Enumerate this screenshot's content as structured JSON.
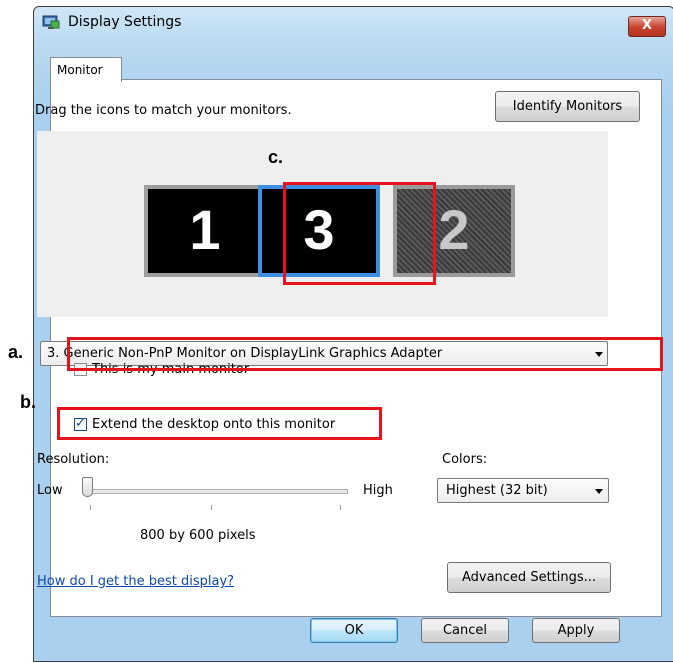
{
  "window": {
    "title": "Display Settings",
    "close_glyph": "X"
  },
  "tabs": [
    {
      "label": "Monitor"
    }
  ],
  "monitor_tab": {
    "drag_hint": "Drag the icons to match your monitors.",
    "identify_button": "Identify Monitors",
    "monitors": [
      {
        "number": "1",
        "selected": false
      },
      {
        "number": "3",
        "selected": true
      },
      {
        "number": "2",
        "selected": false,
        "disabled": true
      }
    ],
    "monitor_select": {
      "value": "3. Generic Non-PnP Monitor on DisplayLink Graphics Adapter"
    },
    "main_monitor": {
      "label": "This is my main monitor",
      "checked": false
    },
    "extend_desktop": {
      "label": "Extend the desktop onto this monitor",
      "checked": true
    },
    "resolution": {
      "label": "Resolution:",
      "low": "Low",
      "high": "High",
      "value_text": "800 by 600 pixels",
      "slider_level": 0
    },
    "colors": {
      "label": "Colors:",
      "value": "Highest (32 bit)"
    },
    "help_link": "How do I get the best display?",
    "advanced_button": "Advanced Settings..."
  },
  "footer": {
    "ok": "OK",
    "cancel": "Cancel",
    "apply": "Apply"
  },
  "annotations": {
    "a": "a.",
    "b": "b.",
    "c": "c.",
    "highlight_color": "#e5141c"
  },
  "icons": {
    "title_icon": "display-monitor-icon",
    "dropdown": "chevron-down-icon"
  }
}
